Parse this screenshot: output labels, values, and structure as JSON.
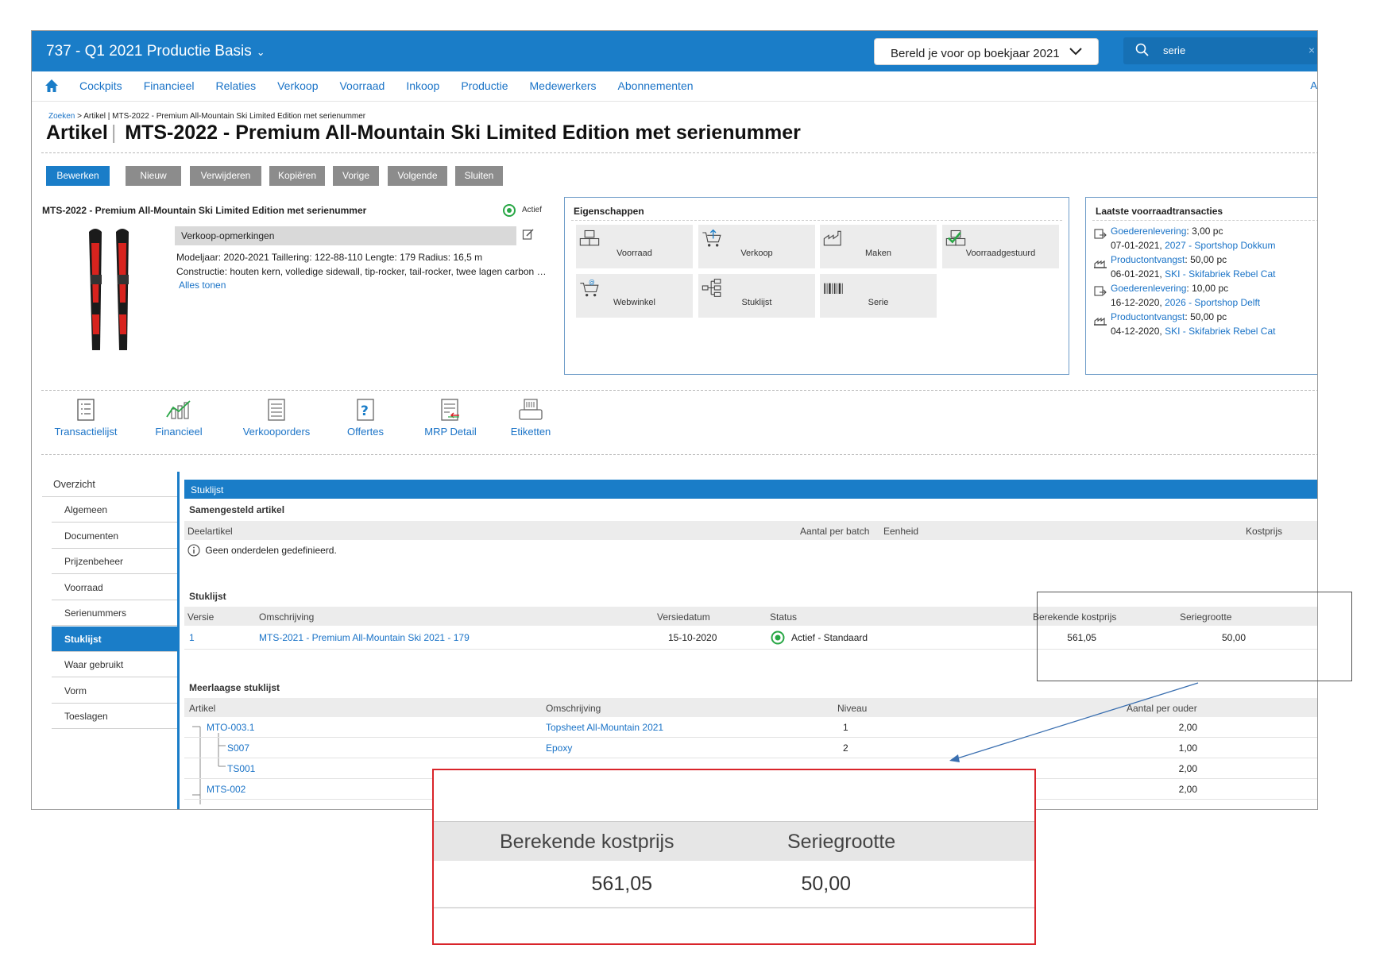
{
  "topbar": {
    "title": "737 - Q1 2021 Productie Basis",
    "title_chevron": "⌄",
    "year_button": "Bereld je voor op boekjaar 2021",
    "search_value": "serie",
    "search_clear": "×"
  },
  "nav": {
    "items": [
      "Cockpits",
      "Financieel",
      "Relaties",
      "Verkoop",
      "Voorraad",
      "Inkoop",
      "Productie",
      "Medewerkers",
      "Abonnementen"
    ],
    "edge_text": "A"
  },
  "breadcrumb": {
    "root": "Zoeken",
    "rest": " > Artikel | MTS-2022 - Premium All-Mountain Ski Limited Edition met serienummer"
  },
  "page": {
    "type": "Artikel",
    "separator": "|",
    "name": "MTS-2022 - Premium All-Mountain Ski Limited Edition met serienummer"
  },
  "toolbar": {
    "buttons": [
      "Bewerken",
      "Nieuw",
      "Verwijderen",
      "Kopiëren",
      "Vorige",
      "Volgende",
      "Sluiten"
    ]
  },
  "article": {
    "title": "MTS-2022 - Premium All-Mountain Ski Limited Edition met serienummer",
    "status": "Actief",
    "remarks_heading": "Verkoop-opmerkingen",
    "remarks_line1": "Modeljaar: 2020-2021 Taillering: 122-88-110 Lengte: 179 Radius: 16,5 m",
    "remarks_line2": "Constructie: houten kern, volledige sidewall, tip-rocker, tail-rocker, twee lagen carbon en titanium",
    "show_all": "Alles tonen"
  },
  "properties": {
    "title": "Eigenschappen",
    "tiles": [
      "Voorraad",
      "Verkoop",
      "Maken",
      "Voorraadgestuurd",
      "Webwinkel",
      "Stuklijst",
      "Serie"
    ]
  },
  "transactions": {
    "title": "Laatste voorraadtransacties",
    "items": [
      {
        "type": "Goederenlevering",
        "qty": ": 3,00 pc",
        "date": "07-01-2021, ",
        "ref": "2027 - Sportshop Dokkum"
      },
      {
        "type": "Productontvangst",
        "qty": ": 50,00 pc",
        "date": "06-01-2021, ",
        "ref": "SKI - Skifabriek Rebel Cat"
      },
      {
        "type": "Goederenlevering",
        "qty": ": 10,00 pc",
        "date": "16-12-2020, ",
        "ref": "2026 - Sportshop Delft"
      },
      {
        "type": "Productontvangst",
        "qty": ": 50,00 pc",
        "date": "04-12-2020, ",
        "ref": "SKI - Skifabriek Rebel Cat"
      }
    ]
  },
  "actions": [
    "Transactielijst",
    "Financieel",
    "Verkooporders",
    "Offertes",
    "MRP Detail",
    "Etiketten"
  ],
  "sidemenu": {
    "header": "Overzicht",
    "items": [
      "Algemeen",
      "Documenten",
      "Prijzenbeheer",
      "Voorraad",
      "Serienummers",
      "Stuklijst",
      "Waar gebruikt",
      "Vorm",
      "Toeslagen"
    ],
    "active_index": 5
  },
  "main": {
    "header": "Stuklijst",
    "composite": {
      "title": "Samengesteld artikel",
      "columns": [
        "Deelartikel",
        "Aantal per batch",
        "Eenheid",
        "Kostprijs"
      ],
      "empty": "Geen onderdelen gedefinieerd."
    },
    "bom": {
      "title": "Stuklijst",
      "columns": [
        "Versie",
        "Omschrijving",
        "Versiedatum",
        "Status",
        "Berekende kostprijs",
        "Seriegrootte"
      ],
      "row": {
        "version": "1",
        "description": "MTS-2021 - Premium All-Mountain Ski 2021 - 179",
        "date": "15-10-2020",
        "status": "Actief - Standaard",
        "cost": "561,05",
        "batch": "50,00"
      }
    },
    "multilevel": {
      "title": "Meerlaagse stuklijst",
      "columns": [
        "Artikel",
        "Omschrijving",
        "Niveau",
        "Aantal per ouder"
      ],
      "rows": [
        {
          "article": "MTO-003.1",
          "description": "Topsheet All-Mountain 2021",
          "level": "1",
          "qty": "2,00"
        },
        {
          "article": "S007",
          "description": "Epoxy",
          "level": "2",
          "qty": "1,00"
        },
        {
          "article": "TS001",
          "description": "",
          "level": "",
          "qty": "2,00"
        },
        {
          "article": "MTS-002",
          "description": "",
          "level": "",
          "qty": "2,00"
        }
      ]
    }
  },
  "zoom": {
    "col_cost": "Berekende kostprijs",
    "col_batch": "Seriegrootte",
    "cost": "561,05",
    "batch": "50,00"
  },
  "colors": {
    "brand_blue": "#1a7dc8",
    "status_green": "#28a745",
    "callout_red": "#d9242a"
  }
}
